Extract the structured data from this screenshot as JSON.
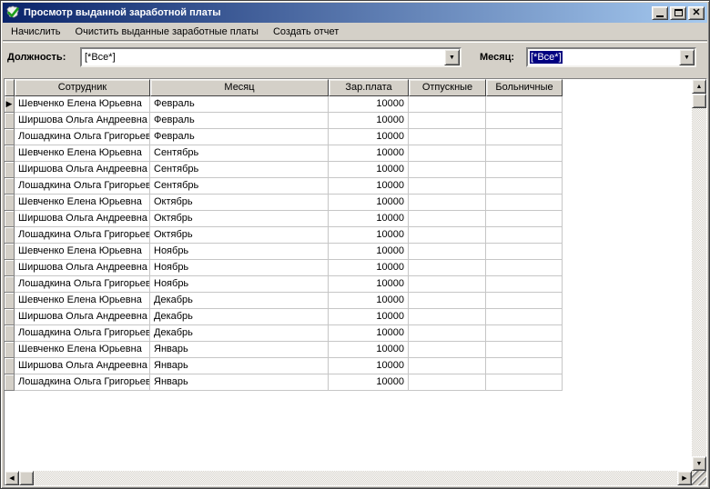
{
  "window": {
    "title": "Просмотр выданной заработной платы"
  },
  "menu": {
    "items": [
      "Начислить",
      "Очистить выданные заработные платы",
      "Создать отчет"
    ]
  },
  "filters": {
    "position_label": "Должность:",
    "position_value": "[*Все*]",
    "month_label": "Месяц:",
    "month_value": "[*Все*]"
  },
  "grid": {
    "columns": [
      "Сотрудник",
      "Месяц",
      "Зар.плата",
      "Отпускные",
      "Больничные"
    ],
    "selected_row_index": 0,
    "rows": [
      {
        "employee": "Шевченко Елена Юрьевна",
        "month": "Февраль",
        "salary": 10000,
        "vacation": "",
        "sick": ""
      },
      {
        "employee": "Ширшова Ольга Андреевна",
        "month": "Февраль",
        "salary": 10000,
        "vacation": "",
        "sick": ""
      },
      {
        "employee": "Лошадкина Ольга Григорьев",
        "month": "Февраль",
        "salary": 10000,
        "vacation": "",
        "sick": ""
      },
      {
        "employee": "Шевченко Елена Юрьевна",
        "month": "Сентябрь",
        "salary": 10000,
        "vacation": "",
        "sick": ""
      },
      {
        "employee": "Ширшова Ольга Андреевна",
        "month": "Сентябрь",
        "salary": 10000,
        "vacation": "",
        "sick": ""
      },
      {
        "employee": "Лошадкина Ольга Григорьев",
        "month": "Сентябрь",
        "salary": 10000,
        "vacation": "",
        "sick": ""
      },
      {
        "employee": "Шевченко Елена Юрьевна",
        "month": "Октябрь",
        "salary": 10000,
        "vacation": "",
        "sick": ""
      },
      {
        "employee": "Ширшова Ольга Андреевна",
        "month": "Октябрь",
        "salary": 10000,
        "vacation": "",
        "sick": ""
      },
      {
        "employee": "Лошадкина Ольга Григорьев",
        "month": "Октябрь",
        "salary": 10000,
        "vacation": "",
        "sick": ""
      },
      {
        "employee": "Шевченко Елена Юрьевна",
        "month": "Ноябрь",
        "salary": 10000,
        "vacation": "",
        "sick": ""
      },
      {
        "employee": "Ширшова Ольга Андреевна",
        "month": "Ноябрь",
        "salary": 10000,
        "vacation": "",
        "sick": ""
      },
      {
        "employee": "Лошадкина Ольга Григорьев",
        "month": "Ноябрь",
        "salary": 10000,
        "vacation": "",
        "sick": ""
      },
      {
        "employee": "Шевченко Елена Юрьевна",
        "month": "Декабрь",
        "salary": 10000,
        "vacation": "",
        "sick": ""
      },
      {
        "employee": "Ширшова Ольга Андреевна",
        "month": "Декабрь",
        "salary": 10000,
        "vacation": "",
        "sick": ""
      },
      {
        "employee": "Лошадкина Ольга Григорьев",
        "month": "Декабрь",
        "salary": 10000,
        "vacation": "",
        "sick": ""
      },
      {
        "employee": "Шевченко Елена Юрьевна",
        "month": "Январь",
        "salary": 10000,
        "vacation": "",
        "sick": ""
      },
      {
        "employee": "Ширшова Ольга Андреевна",
        "month": "Январь",
        "salary": 10000,
        "vacation": "",
        "sick": ""
      },
      {
        "employee": "Лошадкина Ольга Григорьев",
        "month": "Январь",
        "salary": 10000,
        "vacation": "",
        "sick": ""
      }
    ]
  },
  "icons": {
    "app": "green-check-icon",
    "close": "✕",
    "dropdown_arrow": "▼",
    "up_arrow": "▲",
    "down_arrow": "▼",
    "left_arrow": "◀",
    "right_arrow": "▶",
    "record_marker": "▶"
  },
  "colors": {
    "titlebar_gradient_start": "#0a246a",
    "titlebar_gradient_end": "#a6caf0",
    "window_background": "#d4d0c8",
    "selection_background": "#000080",
    "selection_text": "#ffffff",
    "grid_line": "#c6c6c6"
  }
}
